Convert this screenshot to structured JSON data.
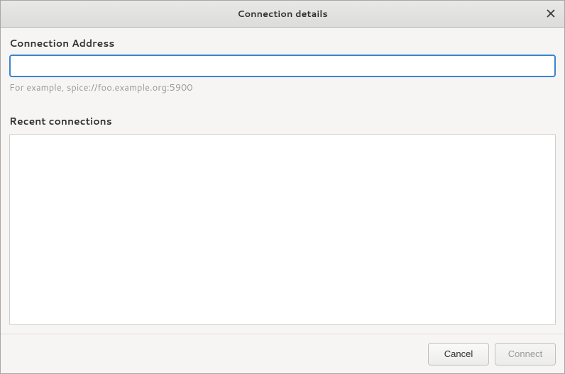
{
  "titlebar": {
    "title": "Connection details"
  },
  "address": {
    "label": "Connection Address",
    "value": "",
    "hint": "For example, spice://foo.example.org:5900"
  },
  "recent": {
    "label": "Recent connections",
    "items": []
  },
  "footer": {
    "cancel_label": "Cancel",
    "connect_label": "Connect",
    "connect_enabled": false
  }
}
